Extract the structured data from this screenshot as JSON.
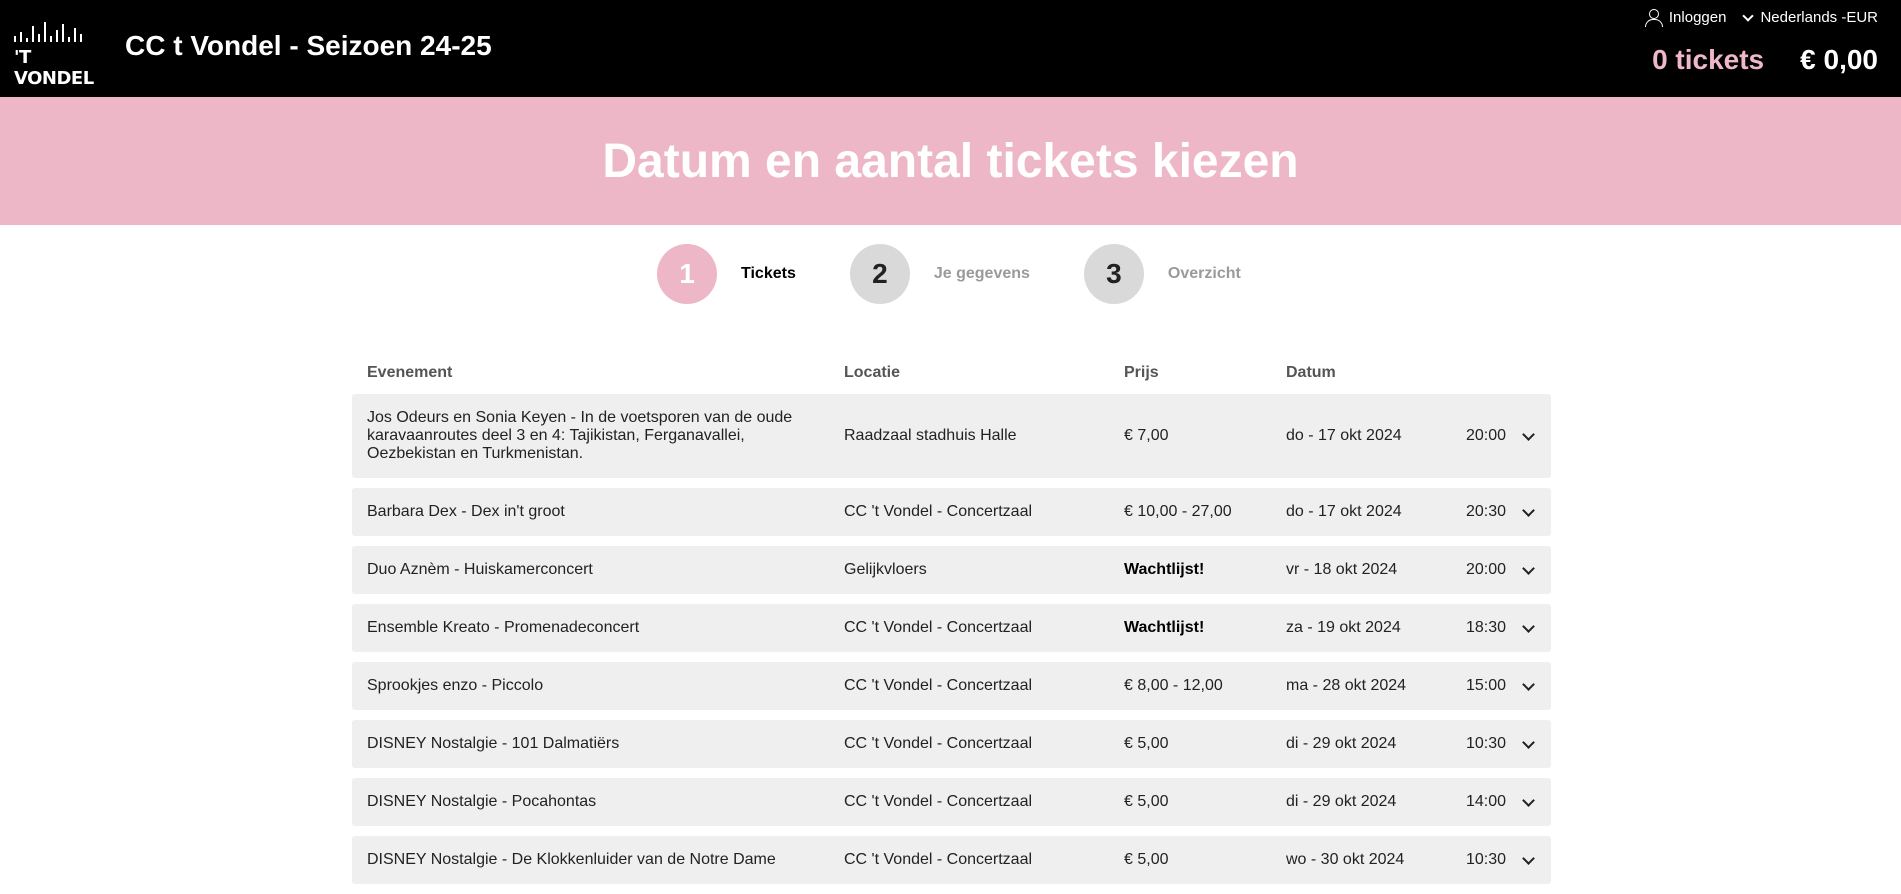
{
  "header": {
    "logo_text": "'T VONDEL",
    "title": "CC t Vondel - Seizoen 24-25",
    "login_label": "Inloggen",
    "language_label": "Nederlands -EUR",
    "cart_tickets": "0 tickets",
    "cart_total": "€ 0,00"
  },
  "hero": {
    "title": "Datum en aantal tickets kiezen"
  },
  "steps": [
    {
      "number": "1",
      "label": "Tickets",
      "active": true
    },
    {
      "number": "2",
      "label": "Je gegevens",
      "active": false
    },
    {
      "number": "3",
      "label": "Overzicht",
      "active": false
    }
  ],
  "table": {
    "columns": [
      "Evenement",
      "Locatie",
      "Prijs",
      "Datum"
    ],
    "rows": [
      {
        "event": "Jos Odeurs en Sonia Keyen - In de voetsporen van de oude karavaanroutes deel 3 en 4: Tajikistan, Ferganavallei, Oezbekistan en Turkmenistan.",
        "location": "Raadzaal stadhuis Halle",
        "price": "€ 7,00",
        "date": "do - 17 okt 2024",
        "time": "20:00"
      },
      {
        "event": "Barbara Dex - Dex in't groot",
        "location": "CC 't Vondel - Concertzaal",
        "price": "€ 10,00 - 27,00",
        "date": "do - 17 okt 2024",
        "time": "20:30"
      },
      {
        "event": "Duo Aznèm - Huiskamerconcert",
        "location": "Gelijkvloers",
        "price": "Wachtlijst!",
        "date": "vr - 18 okt 2024",
        "time": "20:00"
      },
      {
        "event": "Ensemble Kreato - Promenadeconcert",
        "location": "CC 't Vondel - Concertzaal",
        "price": "Wachtlijst!",
        "date": "za - 19 okt 2024",
        "time": "18:30"
      },
      {
        "event": "Sprookjes enzo - Piccolo",
        "location": "CC 't Vondel - Concertzaal",
        "price": "€ 8,00 - 12,00",
        "date": "ma - 28 okt 2024",
        "time": "15:00"
      },
      {
        "event": "DISNEY Nostalgie - 101 Dalmatiërs",
        "location": "CC 't Vondel - Concertzaal",
        "price": "€ 5,00",
        "date": "di - 29 okt 2024",
        "time": "10:30"
      },
      {
        "event": "DISNEY Nostalgie - Pocahontas",
        "location": "CC 't Vondel - Concertzaal",
        "price": "€ 5,00",
        "date": "di - 29 okt 2024",
        "time": "14:00"
      },
      {
        "event": "DISNEY Nostalgie - De Klokkenluider van de Notre Dame",
        "location": "CC 't Vondel - Concertzaal",
        "price": "€ 5,00",
        "date": "wo - 30 okt 2024",
        "time": "10:30"
      }
    ]
  },
  "colors": {
    "pink": "#edb7c7",
    "header_bg": "#000000",
    "row_bg": "#efefef"
  }
}
